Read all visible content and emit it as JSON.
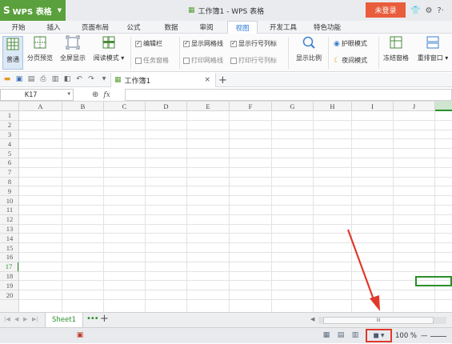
{
  "titlebar": {
    "app_name": "WPS 表格",
    "logo_glyph": "S",
    "doc_title": "工作簿1 - WPS 表格",
    "login_label": "未登录",
    "icons": [
      "shirt-icon",
      "settings-icon",
      "help-icon"
    ]
  },
  "menu": {
    "tabs": [
      "开始",
      "插入",
      "页面布局",
      "公式",
      "数据",
      "审阅",
      "视图",
      "开发工具",
      "特色功能"
    ],
    "active": "视图"
  },
  "ribbon": {
    "normal": "普通",
    "page_break": "分页预览",
    "fullscreen": "全屏显示",
    "reading_mode": "阅读模式",
    "edit_bar": "编辑栏",
    "task_pane": "任务窗格",
    "show_gridlines": "显示网格线",
    "print_gridlines": "打印网格线",
    "show_headers": "显示行号列标",
    "print_headers": "打印行号列标",
    "zoom": "显示比例",
    "eye_protect": "护眼模式",
    "night_mode": "夜间模式",
    "freeze": "冻结窗格",
    "rearrange": "重排窗口"
  },
  "quickbar": {
    "doc_tab": "工作簿1",
    "close": "×",
    "new_tab": "+"
  },
  "formula": {
    "cell_ref": "K17",
    "fx": "fx",
    "value": ""
  },
  "columns": [
    "A",
    "B",
    "C",
    "D",
    "E",
    "F",
    "G",
    "H",
    "I",
    "J"
  ],
  "rows": [
    "1",
    "2",
    "3",
    "4",
    "5",
    "6",
    "7",
    "8",
    "9",
    "10",
    "11",
    "12",
    "13",
    "14",
    "15",
    "16",
    "17",
    "18",
    "19",
    "20"
  ],
  "active_row": "17",
  "sheets": {
    "tabs": [
      "Sheet1"
    ],
    "more": "•••",
    "add": "+",
    "scroll_label": "III"
  },
  "status": {
    "zoom": "100 %",
    "zoom_minus": "—"
  },
  "colors": {
    "app_green": "#5aa03c",
    "login_red": "#e95d3c",
    "active_tab_blue": "#2d7bd8",
    "selection_green": "#2a8f2a",
    "annotation_red": "#e0392b"
  }
}
